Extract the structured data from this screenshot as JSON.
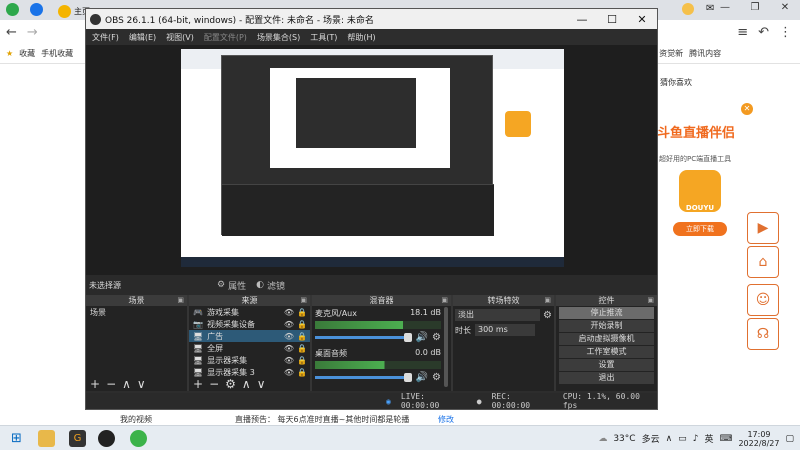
{
  "browser": {
    "tab_title": "主页",
    "bookmarks": [
      "收藏",
      "手机收藏"
    ],
    "bookmarks_right": [
      "资觉新",
      "腾讯内容"
    ],
    "right_heading": "猜你喜欢",
    "page_text": "直播预告： 每天6点准时直播~其他时间都是轮播",
    "page_link": "修改",
    "page_left": "我的视频"
  },
  "obs": {
    "title": "OBS 26.1.1 (64-bit, windows) - 配置文件: 未命名 - 场景: 未命名",
    "menu": [
      "文件(F)",
      "编辑(E)",
      "视图(V)",
      "配置文件(P)",
      "场景集合(S)",
      "工具(T)",
      "帮助(H)"
    ],
    "no_source": "未选择源",
    "properties": "属性",
    "filters": "滤镜",
    "docks": {
      "scenes": {
        "title": "场景",
        "items": [
          "场景"
        ]
      },
      "sources": {
        "title": "来源",
        "items": [
          {
            "icon": "🎮",
            "name": "游戏采集"
          },
          {
            "icon": "📷",
            "name": "视频采集设备"
          },
          {
            "icon": "🖥",
            "name": "广告"
          },
          {
            "icon": "🖥",
            "name": "全屏"
          },
          {
            "icon": "🖥",
            "name": "显示器采集"
          },
          {
            "icon": "🖥",
            "name": "显示器采集 3"
          }
        ]
      },
      "mixer": {
        "title": "混音器",
        "channels": [
          {
            "name": "麦克风/Aux",
            "level": "18.1 dB"
          },
          {
            "name": "桌面音频",
            "level": "0.0 dB"
          }
        ]
      },
      "transitions": {
        "title": "转场特效",
        "type": "淡出",
        "duration_label": "时长",
        "duration": "300 ms"
      },
      "controls": {
        "title": "控件",
        "buttons": [
          "停止推流",
          "开始录制",
          "启动虚拟摄像机",
          "工作室模式",
          "设置",
          "退出"
        ]
      }
    },
    "status": {
      "live": "LIVE: 00:00:00",
      "rec": "REC: 00:00:00",
      "cpu": "CPU: 1.1%, 60.00 fps"
    }
  },
  "promo": {
    "title": "斗鱼直播伴侣",
    "subtitle": "超好用的PC端直播工具",
    "logo": "DOUYU",
    "button": "立即下载"
  },
  "taskbar": {
    "temperature": "33°C",
    "weather": "多云",
    "ime": "英",
    "time": "17:09",
    "date": "2022/8/27"
  },
  "colors": {
    "accent": "#e07030",
    "obs_bg": "#2d2d2d",
    "selection": "#2d5a78"
  }
}
